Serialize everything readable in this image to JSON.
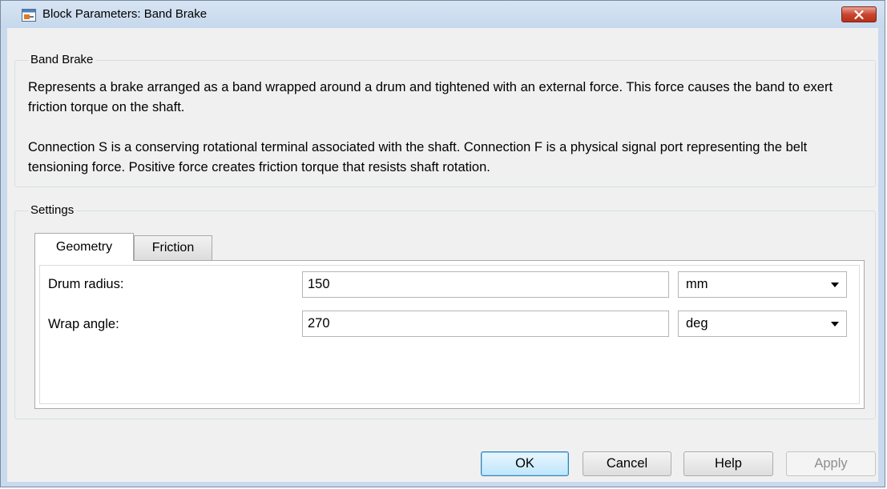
{
  "window": {
    "title": "Block Parameters: Band Brake"
  },
  "description_group": {
    "legend": "Band Brake",
    "paragraph1": "Represents a brake arranged as a band wrapped around a drum and tightened with an external force. This force causes the band to exert friction torque on the shaft.",
    "paragraph2": "Connection S is a conserving rotational terminal associated with the shaft. Connection F is a physical signal port representing the belt tensioning force. Positive force creates friction torque that resists shaft rotation."
  },
  "settings": {
    "legend": "Settings",
    "tabs": [
      {
        "label": "Geometry",
        "active": true
      },
      {
        "label": "Friction",
        "active": false
      }
    ],
    "parameters": [
      {
        "label": "Drum radius:",
        "value": "150",
        "unit": "mm"
      },
      {
        "label": "Wrap angle:",
        "value": "270",
        "unit": "deg"
      }
    ]
  },
  "buttons": {
    "ok": "OK",
    "cancel": "Cancel",
    "help": "Help",
    "apply": "Apply"
  },
  "colors": {
    "frame": "#c9daee",
    "close_button": "#c9452f",
    "default_button_border": "#3c7fb1"
  }
}
